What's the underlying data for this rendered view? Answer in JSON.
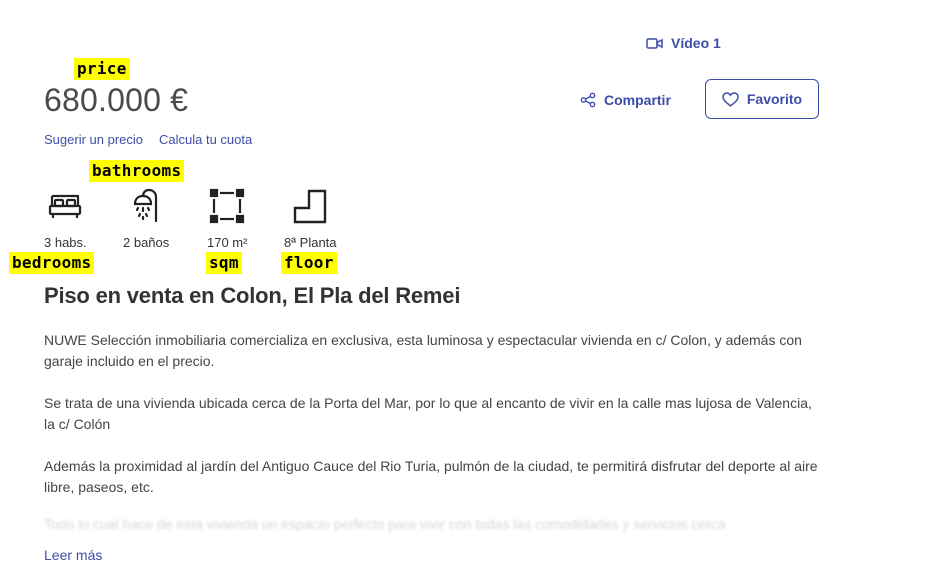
{
  "video": {
    "label": "Vídeo 1",
    "icon": "video-camera-icon"
  },
  "price": {
    "value": "680.000 €"
  },
  "price_links": {
    "suggest": "Sugerir un precio",
    "calculate": "Calcula tu cuota"
  },
  "actions": {
    "share": {
      "label": "Compartir",
      "icon": "share-icon"
    },
    "favorite": {
      "label": "Favorito",
      "icon": "heart-icon"
    }
  },
  "features": [
    {
      "label": "3 habs.",
      "icon": "bed-icon"
    },
    {
      "label": "2 baños",
      "icon": "shower-icon"
    },
    {
      "label": "170 m²",
      "icon": "area-icon"
    },
    {
      "label": "8ª Planta",
      "icon": "floor-stairs-icon"
    }
  ],
  "annotations": {
    "price": "price",
    "bathrooms": "bathrooms",
    "bedrooms": "bedrooms",
    "sqm": "sqm",
    "floor": "floor"
  },
  "listing": {
    "title": "Piso en venta en Colon, El Pla del Remei",
    "paragraphs": [
      "NUWE Selección inmobiliaria comercializa en exclusiva, esta luminosa y espectacular vivienda en c/ Colon, y además con garaje incluido en el precio.",
      "Se trata de una vivienda ubicada cerca de la Porta del Mar, por lo que al encanto de vivir en la calle mas lujosa de Valencia, la c/ Colón",
      "Además la proximidad al jardín del Antiguo Cauce del Rio Turia, pulmón de la ciudad, te permitirá disfrutar del deporte al aire libre, paseos, etc."
    ],
    "faded_text": "Todo lo cual hace de esta vivienda un espacio perfecto para vivir con todas las comodidades y servicios cerca",
    "read_more": "Leer más"
  },
  "colors": {
    "accent": "#3d4da8",
    "highlight": "#ffff00",
    "text": "#333333"
  }
}
